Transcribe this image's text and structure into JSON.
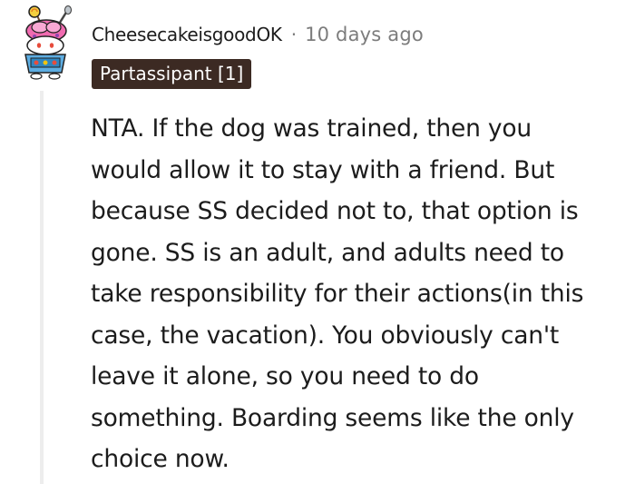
{
  "comment": {
    "username": "CheesecakeisgoodOK",
    "separator": "·",
    "timestamp": "10 days ago",
    "flair": "Partassipant [1]",
    "avatar_icon": "snoo-ice-cream-avatar-icon",
    "body_lines": [
      "NTA. If the dog was trained, then you",
      "would allow it to stay with a friend. But",
      "because SS decided not to, that option is",
      "gone. SS is an adult, and adults need to",
      "take responsibility for their actions(in this",
      "case, the vacation). You obviously can't",
      "leave it alone, so you need to do",
      "something. Boarding seems like the only",
      "choice now."
    ]
  },
  "colors": {
    "flair_background": "#3c2a23",
    "flair_text": "#ffffff",
    "body_text": "#1c1c1c",
    "meta_text": "#7c7c7c",
    "thread_line": "#ededed"
  }
}
